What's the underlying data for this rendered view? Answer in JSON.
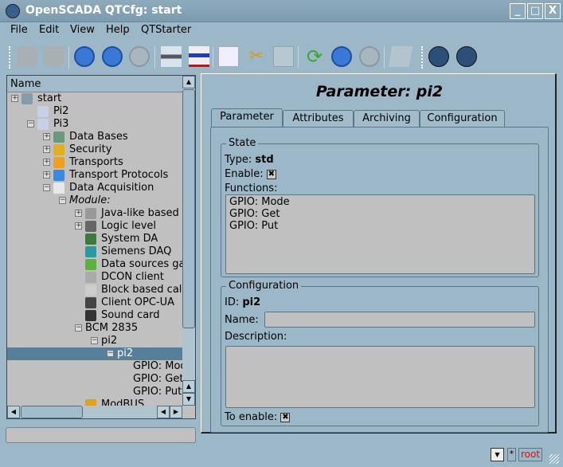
{
  "window": {
    "title": "OpenSCADA QTCfg: start",
    "minimize": "_",
    "maximize": "□",
    "close": "X"
  },
  "menu": [
    "File",
    "Edit",
    "View",
    "Help",
    "QTStarter"
  ],
  "toolbar": [
    "db-load-icon",
    "db-save-icon",
    "up-icon",
    "back-icon",
    "forward-icon",
    "add-item-icon",
    "delete-item-icon",
    "copy-icon",
    "cut-icon",
    "paste-icon",
    "refresh-icon",
    "start-icon",
    "stop-icon",
    "help-icon",
    "qtcfg-icon",
    "vision-icon"
  ],
  "tree": {
    "header": "Name",
    "items": [
      {
        "label": "start",
        "level": 0,
        "exp": "+"
      },
      {
        "label": "Pi2",
        "level": 1,
        "exp": ""
      },
      {
        "label": "Pi3",
        "level": 1,
        "exp": "-"
      },
      {
        "label": "Data Bases",
        "level": 2,
        "exp": "+"
      },
      {
        "label": "Security",
        "level": 2,
        "exp": "+"
      },
      {
        "label": "Transports",
        "level": 2,
        "exp": "+"
      },
      {
        "label": "Transport Protocols",
        "level": 2,
        "exp": "+"
      },
      {
        "label": "Data Acquisition",
        "level": 2,
        "exp": "-"
      },
      {
        "label": "Module:",
        "level": 3,
        "exp": "-"
      },
      {
        "label": "Java-like based calculator",
        "level": 4,
        "exp": "+"
      },
      {
        "label": "Logic level",
        "level": 4,
        "exp": "+"
      },
      {
        "label": "System DA",
        "level": 4,
        "exp": ""
      },
      {
        "label": "Siemens DAQ",
        "level": 4,
        "exp": ""
      },
      {
        "label": "Data sources gate",
        "level": 4,
        "exp": ""
      },
      {
        "label": "DCON client",
        "level": 4,
        "exp": ""
      },
      {
        "label": "Block based calculator",
        "level": 4,
        "exp": ""
      },
      {
        "label": "Client OPC-UA",
        "level": 4,
        "exp": ""
      },
      {
        "label": "Sound card",
        "level": 4,
        "exp": ""
      },
      {
        "label": "BCM 2835",
        "level": 4,
        "exp": "-"
      },
      {
        "label": "pi2",
        "level": 5,
        "exp": "-"
      },
      {
        "label": "pi2",
        "level": 6,
        "exp": "-",
        "selected": true
      },
      {
        "label": "GPIO: Mode",
        "level": 7,
        "exp": ""
      },
      {
        "label": "GPIO: Get",
        "level": 7,
        "exp": ""
      },
      {
        "label": "GPIO: Put",
        "level": 7,
        "exp": ""
      },
      {
        "label": "ModBUS",
        "level": 4,
        "exp": ""
      }
    ]
  },
  "page": {
    "title": "Parameter: pi2",
    "tabs": [
      "Parameter",
      "Attributes",
      "Archiving",
      "Configuration"
    ],
    "state": {
      "legend": "State",
      "type_label": "Type:",
      "type_value": "std",
      "enable_label": "Enable:",
      "enable_checked": true,
      "functions_label": "Functions:",
      "functions": [
        "GPIO: Mode",
        "GPIO: Get",
        "GPIO: Put"
      ]
    },
    "config": {
      "legend": "Configuration",
      "id_label": "ID:",
      "id_value": "pi2",
      "name_label": "Name:",
      "name_value": "",
      "desc_label": "Description:",
      "desc_value": "",
      "to_enable_label": "To enable:",
      "to_enable_checked": true
    }
  },
  "statusbar": {
    "star": "*",
    "user": "root",
    "user_color": "#ff0000"
  }
}
